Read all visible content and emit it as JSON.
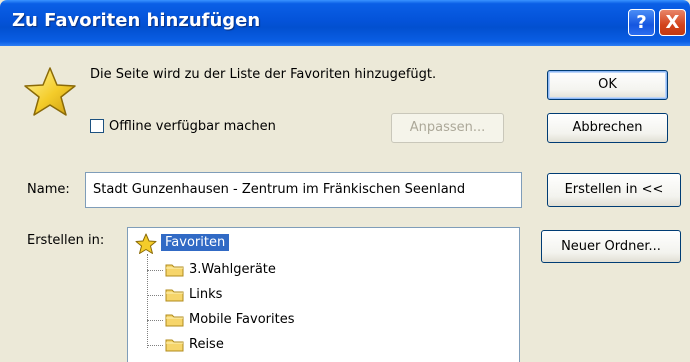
{
  "window": {
    "title": "Zu Favoriten hinzufügen",
    "help_label": "?",
    "close_label": "X"
  },
  "message": "Die Seite wird zu der Liste der Favoriten hinzugefügt.",
  "offline": {
    "label": "Offline verfügbar machen",
    "checked": false
  },
  "buttons": {
    "ok": "OK",
    "cancel": "Abbrechen",
    "customize": "Anpassen...",
    "create_in": "Erstellen in <<",
    "new_folder": "Neuer Ordner..."
  },
  "name": {
    "label": "Name:",
    "value": "Stadt Gunzenhausen - Zentrum im Fränkischen Seenland"
  },
  "create_in": {
    "label": "Erstellen in:",
    "root": "Favoriten",
    "folders": [
      "3.Wahlgeräte",
      "Links",
      "Mobile Favorites",
      "Reise"
    ]
  },
  "colors": {
    "titlebar": "#0453d9",
    "dialog_bg": "#ece9d8",
    "selection": "#316ac5",
    "button_border": "#003c74"
  }
}
